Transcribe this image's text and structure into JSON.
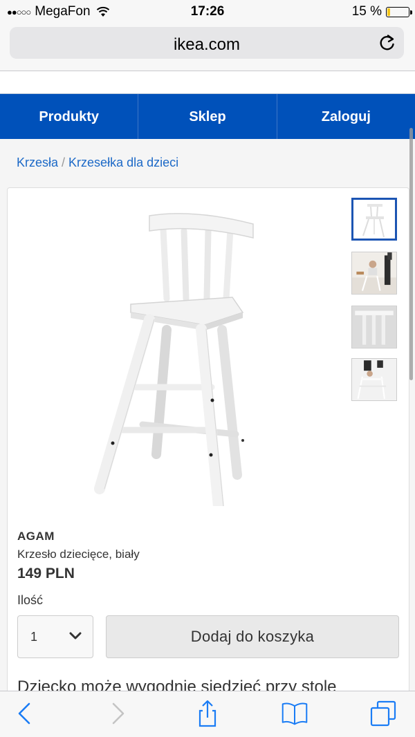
{
  "status_bar": {
    "signal": "●●○○○",
    "carrier": "MegaFon",
    "time": "17:26",
    "battery": "15 %",
    "battery_level": 0.15,
    "battery_color": "#f5c518"
  },
  "address_bar": {
    "url": "ikea.com",
    "reload_icon": "reload-icon"
  },
  "nav": {
    "items": [
      {
        "label": "Produkty"
      },
      {
        "label": "Sklep"
      },
      {
        "label": "Zaloguj"
      }
    ],
    "color": "#0051ba"
  },
  "breadcrumb": {
    "items": [
      "Krzesła",
      "Krzesełka dla dzieci"
    ],
    "separator": "/"
  },
  "product": {
    "name": "AGAM",
    "description": "Krzesło dziecięce, biały",
    "price": "149 PLN",
    "quantity_label": "Ilość",
    "quantity_value": "1",
    "add_to_cart": "Dodaj do koszyka",
    "long_description": "Dziecko może wygodnie siedzieć przy stole",
    "thumbnails": [
      "chair-front",
      "chair-with-child",
      "chair-back-detail",
      "chair-child-climbing"
    ],
    "active_thumbnail": 0
  },
  "toolbar": {
    "icons": [
      "back-icon",
      "forward-icon",
      "share-icon",
      "bookmarks-icon",
      "tabs-icon"
    ]
  }
}
